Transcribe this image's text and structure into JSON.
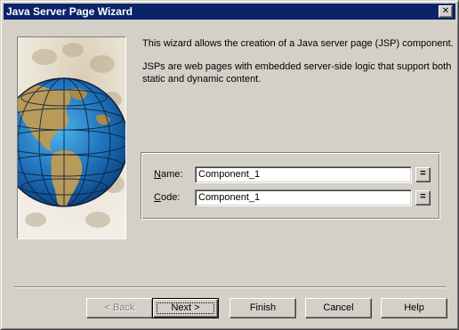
{
  "window": {
    "title": "Java Server Page Wizard",
    "close_glyph": "✕"
  },
  "intro": {
    "line1": "This wizard allows the creation of a Java server page (JSP) component.",
    "line2": "JSPs are web pages with embedded server-side logic that support both static and dynamic content."
  },
  "form": {
    "name_label_key": "N",
    "name_label_rest": "ame:",
    "name_value": "Component_1",
    "code_label_key": "C",
    "code_label_rest": "ode:",
    "code_value": "Component_1",
    "equals_glyph": "="
  },
  "buttons": {
    "back_label": "< Back",
    "next_label": "Next >",
    "finish_label": "Finish",
    "cancel_label": "Cancel",
    "help_label": "Help"
  },
  "icons": {
    "wizard_image": "globe-image"
  },
  "colors": {
    "titlebar": "#0a246a",
    "dialog_face": "#d4d0c8",
    "ocean": "#1d6fb8",
    "land": "#b99a5a"
  }
}
